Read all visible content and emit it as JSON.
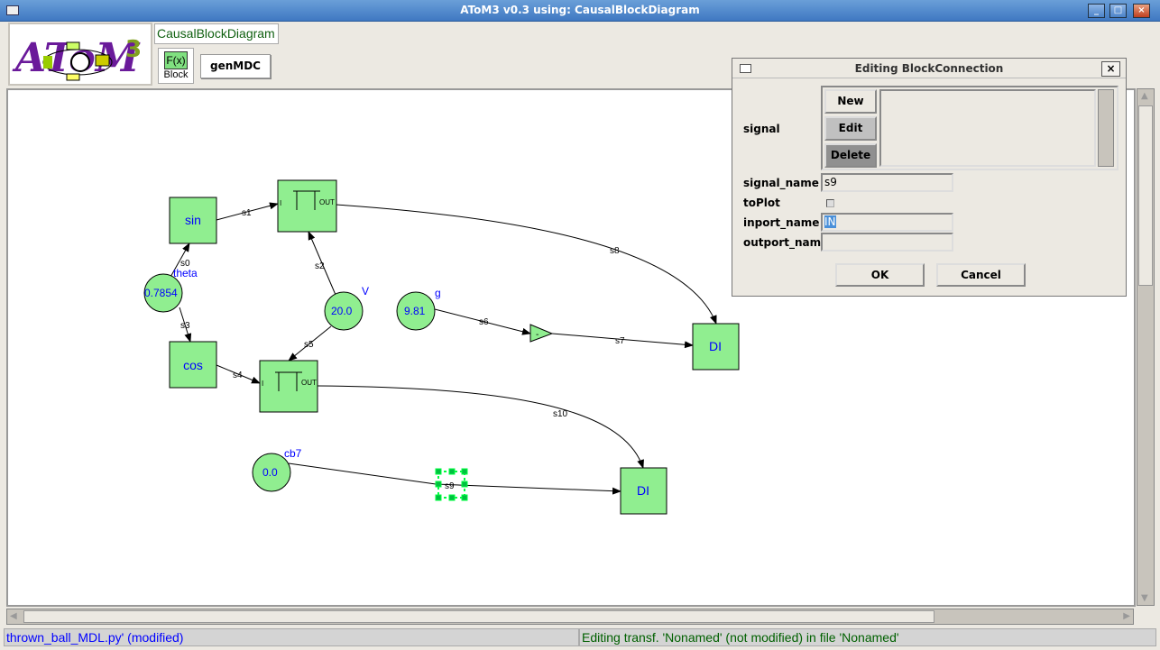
{
  "window": {
    "title": "AToM3 v0.3 using: CausalBlockDiagram",
    "controls": [
      "_",
      "□",
      "×"
    ]
  },
  "toolbar": {
    "logo_text": "AToM3",
    "metamodel": "CausalBlockDiagram",
    "block_button": {
      "icon_text": "F(x)",
      "label": "Block"
    },
    "genmdc_label": "genMDC"
  },
  "diagram": {
    "blocks": {
      "sin": "sin",
      "cos": "cos",
      "di_top": "DI",
      "di_bottom": "DI",
      "negate": "-",
      "integ_out": "OUT",
      "integ_in": "I"
    },
    "constants": [
      {
        "name": "theta",
        "value": "0.7854"
      },
      {
        "name": "V",
        "value": "20.0"
      },
      {
        "name": "g",
        "value": "9.81"
      },
      {
        "name": "cb7",
        "value": "0.0"
      }
    ],
    "signals": [
      "s0",
      "s1",
      "s2",
      "s3",
      "s4",
      "s5",
      "s6",
      "s7",
      "s8",
      "s9",
      "s10"
    ],
    "fill_color": "#90ee90",
    "text_color": "#0000ff",
    "selection_color": "#00ff40"
  },
  "dialog": {
    "title": "Editing BlockConnection",
    "signal_label": "signal",
    "new": "New",
    "edit": "Edit",
    "delete": "Delete",
    "signal_name_label": "signal_name",
    "signal_name_value": "s9",
    "toplot_label": "toPlot",
    "toplot_checked": false,
    "inport_name_label": "inport_name",
    "inport_name_value": "IN",
    "outport_name_label": "outport_name",
    "outport_name_value": "",
    "ok": "OK",
    "cancel": "Cancel"
  },
  "status": {
    "left": "thrown_ball_MDL.py' (modified)",
    "right": "Editing transf. 'Nonamed' (not modified) in file 'Nonamed'"
  }
}
